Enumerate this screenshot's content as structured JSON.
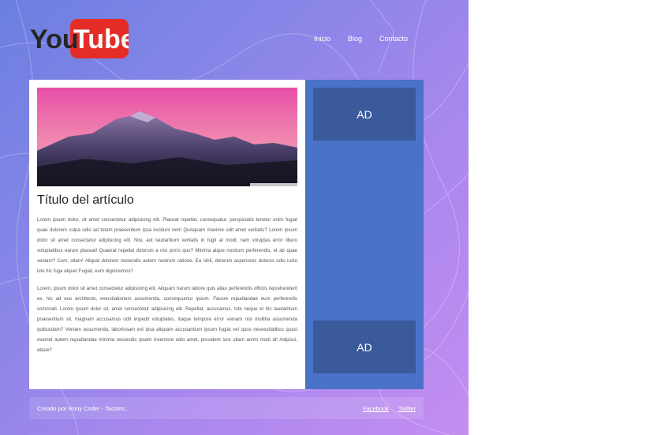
{
  "brand": {
    "logo_left": "You",
    "logo_right": "Tube"
  },
  "nav": {
    "items": [
      "Inicio",
      "Blog",
      "Contacto"
    ]
  },
  "article": {
    "title": "Título del artículo",
    "paragraphs": [
      "Lorem ipsum dolor, sit amet consectetur adipisicing elit. Placeat repellat, consequatur, perspiciatis tenetur enim fugiat quae dolorem culpa odio ad totam praesentium ipsa incidunt rem! Quisquam maxime odit amet veritatis? Lorem ipsum dolor sit amet consectetur adipisicing elit. Nisi, aut laudantium veritatis in fugit at modi, nam voluptas error libero voluptatibus earum placeat! Quaerat repellat dolorum a nisi porro quo? Minima atque nostrum perferendis, et ab quae veniam? Cum, ullam! Aliquid dolorem reiciendis autem nostrum ratione. Ea nihil, dolorum asperiores dolores odio iusto iste hic fuga atque! Fugiat, eum dignissimos?",
      "Lorem, ipsum dolor sit amet consectetur adipisicing elit. Aliquam harum labore quis alias perferendis officiis reprehenderit ex, hic ad eos architecto, exercitationem assumenda, consequuntur ipsum. Facere repudiandae eum perferendis commodi. Lorem ipsum dolor sit, amet consectetur adipisicing elit. Repellat, accusamus. Iste neque et hic laudantium praesentium sit, magnam accusamus odit impedit voluptates, itaque tempore error veniam nisi mollitia assumenda quibusdam? Veniam assumenda, laboriosam est ipsa aliquam accusantium ipsum fugiat vel quos necessitatibus quasi eveniet autem repudiandae minima reiciendis ipsam inventore odio amet, provident iure ullam animi modi id! Adipisci, atque?"
    ]
  },
  "sidebar": {
    "ads": [
      "AD",
      "AD"
    ]
  },
  "footer": {
    "credit": "Creado por Rony Coder - TacoInc.",
    "links": [
      "Facebook",
      "Twitter"
    ]
  },
  "colors": {
    "background_start": "#6b7fe0",
    "background_end": "#c48ef0",
    "sidebar": "#4a72c8",
    "ad_box": "#3a5a9c",
    "logo_red": "#e52d27"
  }
}
